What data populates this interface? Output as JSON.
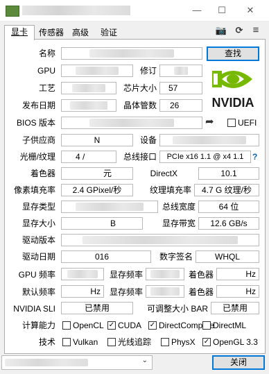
{
  "window": {
    "title": "GPU-Z"
  },
  "tabs": [
    "显卡",
    "传感器",
    "高级",
    "验证"
  ],
  "toolbar": {
    "camera_icon": "camera-icon",
    "refresh_icon": "refresh-icon",
    "menu_icon": "menu-icon"
  },
  "labels": {
    "name": "名称",
    "gpu": "GPU",
    "revision": "修订",
    "process": "工艺",
    "die_size": "芯片大小",
    "release_date": "发布日期",
    "transistors": "晶体管数",
    "bios": "BIOS 版本",
    "subvendor": "子供应商",
    "device": "设备",
    "rops_tmus": "光栅/纹理",
    "bus": "总线接口",
    "shaders": "着色器",
    "directx": "DirectX",
    "pixel_fill": "像素填充率",
    "texture_fill": "纹理填充率",
    "mem_type": "显存类型",
    "bus_width": "总线宽度",
    "mem_size": "显存大小",
    "bandwidth": "显存带宽",
    "driver_version": "驱动版本",
    "driver_date": "驱动日期",
    "signature": "数字签名",
    "gpu_clock": "GPU 频率",
    "mem_clock": "显存频率",
    "shader_clock": "着色器",
    "default_clock": "默认频率",
    "sli": "NVIDIA SLI",
    "rebar": "可调整大小 BAR",
    "compute": "计算能力",
    "tech": "技术"
  },
  "values": {
    "die_size": "57",
    "transistors": "26",
    "rops_tmus": "4 /",
    "bus": "PCIe x16 1.1 @ x4 1.1",
    "shaders_suffix": "元",
    "directx": "10.1",
    "pixel_fill": "2.4 GPixel/秒",
    "texture_fill": "4.7 G 纹理/秒",
    "bus_width": "64 位",
    "bandwidth": "12.6 GB/s",
    "driver_date": "016",
    "signature": "WHQL",
    "sli": "已禁用",
    "rebar": "已禁用",
    "gpu_clock_unit": "Hz",
    "default_clock_unit": "Hz",
    "shader_clock_unit": "Hz",
    "subvendor_short": "N",
    "mem_size_suffix": "B"
  },
  "buttons": {
    "lookup": "查找",
    "close": "关闭"
  },
  "bios_uefi": "UEFI",
  "help": "?",
  "compute": [
    {
      "label": "OpenCL",
      "checked": false
    },
    {
      "label": "CUDA",
      "checked": true
    },
    {
      "label": "DirectCompute",
      "checked": true
    },
    {
      "label": "DirectML",
      "checked": false
    }
  ],
  "tech": [
    {
      "label": "Vulkan",
      "checked": false
    },
    {
      "label": "光线追踪",
      "checked": false
    },
    {
      "label": "PhysX",
      "checked": false
    },
    {
      "label": "OpenGL 3.3",
      "checked": true
    }
  ],
  "brand": {
    "text": "NVIDIA",
    "color": "#76b900"
  }
}
